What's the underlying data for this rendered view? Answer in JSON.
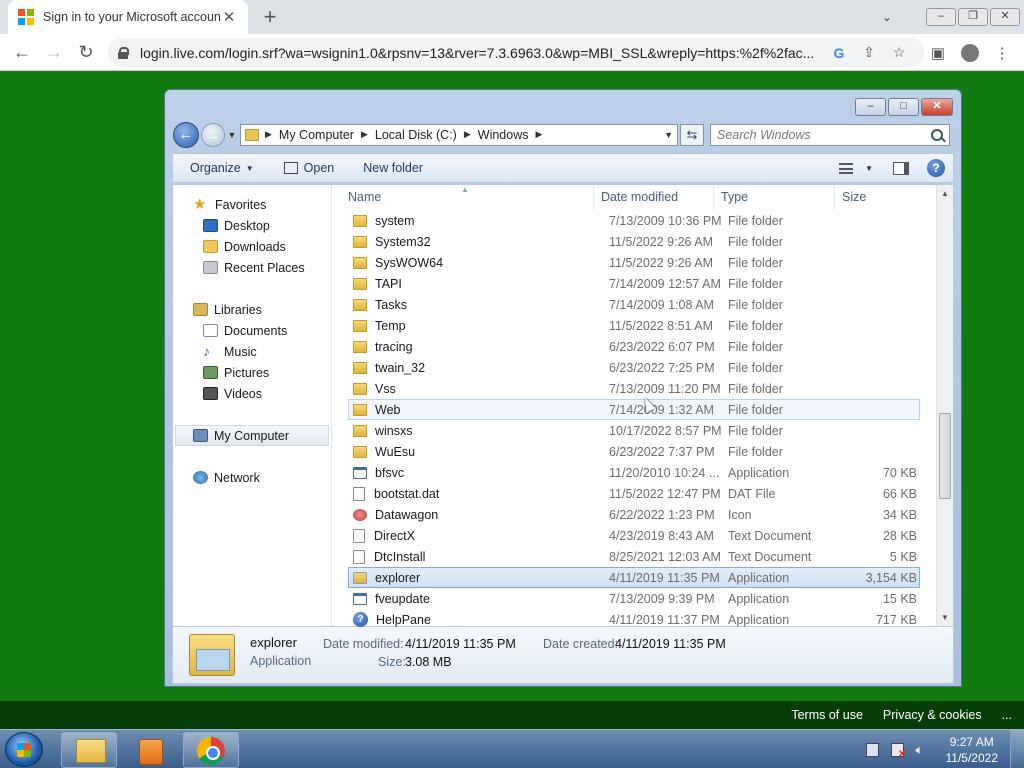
{
  "browser": {
    "tab_title": "Sign in to your Microsoft accoun",
    "url": "login.live.com/login.srf?wa=wsignin1.0&rpsnv=13&rver=7.3.6963.0&wp=MBI_SSL&wreply=https:%2f%2fac..."
  },
  "explorer": {
    "breadcrumb": [
      "My Computer",
      "Local Disk (C:)",
      "Windows"
    ],
    "search_placeholder": "Search Windows",
    "commands": {
      "organize": "Organize",
      "open": "Open",
      "new_folder": "New folder"
    },
    "nav": {
      "favorites": "Favorites",
      "desktop": "Desktop",
      "downloads": "Downloads",
      "recent": "Recent Places",
      "libraries": "Libraries",
      "documents": "Documents",
      "music": "Music",
      "pictures": "Pictures",
      "videos": "Videos",
      "computer": "My Computer",
      "network": "Network"
    },
    "columns": {
      "name": "Name",
      "date": "Date modified",
      "type": "Type",
      "size": "Size"
    },
    "rows": [
      {
        "name": "system",
        "date": "7/13/2009 10:36 PM",
        "type": "File folder",
        "size": "",
        "icon": "folder"
      },
      {
        "name": "System32",
        "date": "11/5/2022 9:26 AM",
        "type": "File folder",
        "size": "",
        "icon": "folder"
      },
      {
        "name": "SysWOW64",
        "date": "11/5/2022 9:26 AM",
        "type": "File folder",
        "size": "",
        "icon": "folder"
      },
      {
        "name": "TAPI",
        "date": "7/14/2009 12:57 AM",
        "type": "File folder",
        "size": "",
        "icon": "folder"
      },
      {
        "name": "Tasks",
        "date": "7/14/2009 1:08 AM",
        "type": "File folder",
        "size": "",
        "icon": "folder"
      },
      {
        "name": "Temp",
        "date": "11/5/2022 8:51 AM",
        "type": "File folder",
        "size": "",
        "icon": "folder"
      },
      {
        "name": "tracing",
        "date": "6/23/2022 6:07 PM",
        "type": "File folder",
        "size": "",
        "icon": "folder"
      },
      {
        "name": "twain_32",
        "date": "6/23/2022 7:25 PM",
        "type": "File folder",
        "size": "",
        "icon": "folder"
      },
      {
        "name": "Vss",
        "date": "7/13/2009 11:20 PM",
        "type": "File folder",
        "size": "",
        "icon": "folder"
      },
      {
        "name": "Web",
        "date": "7/14/2009 1:32 AM",
        "type": "File folder",
        "size": "",
        "icon": "folder"
      },
      {
        "name": "winsxs",
        "date": "10/17/2022 8:57 PM",
        "type": "File folder",
        "size": "",
        "icon": "folder"
      },
      {
        "name": "WuEsu",
        "date": "6/23/2022 7:37 PM",
        "type": "File folder",
        "size": "",
        "icon": "folder"
      },
      {
        "name": "bfsvc",
        "date": "11/20/2010 10:24 ...",
        "type": "Application",
        "size": "70 KB",
        "icon": "app"
      },
      {
        "name": "bootstat.dat",
        "date": "11/5/2022 12:47 PM",
        "type": "DAT File",
        "size": "66 KB",
        "icon": "file"
      },
      {
        "name": "Datawagon",
        "date": "6/22/2022 1:23 PM",
        "type": "Icon",
        "size": "34 KB",
        "icon": "ico"
      },
      {
        "name": "DirectX",
        "date": "4/23/2019 8:43 AM",
        "type": "Text Document",
        "size": "28 KB",
        "icon": "doc"
      },
      {
        "name": "DtcInstall",
        "date": "8/25/2021 12:03 AM",
        "type": "Text Document",
        "size": "5 KB",
        "icon": "doc"
      },
      {
        "name": "explorer",
        "date": "4/11/2019 11:35 PM",
        "type": "Application",
        "size": "3,154 KB",
        "icon": "explorer"
      },
      {
        "name": "fveupdate",
        "date": "7/13/2009 9:39 PM",
        "type": "Application",
        "size": "15 KB",
        "icon": "app"
      },
      {
        "name": "HelpPane",
        "date": "4/11/2019 11:37 PM",
        "type": "Application",
        "size": "717 KB",
        "icon": "help"
      }
    ],
    "details": {
      "name": "explorer",
      "type": "Application",
      "modified_label": "Date modified:",
      "modified": "4/11/2019 11:35 PM",
      "created_label": "Date created:",
      "created": "4/11/2019 11:35 PM",
      "size_label": "Size:",
      "size": "3.08 MB"
    }
  },
  "footer": {
    "terms": "Terms of use",
    "privacy": "Privacy & cookies",
    "more": "..."
  },
  "taskbar": {
    "time": "9:27 AM",
    "date": "11/5/2022"
  }
}
